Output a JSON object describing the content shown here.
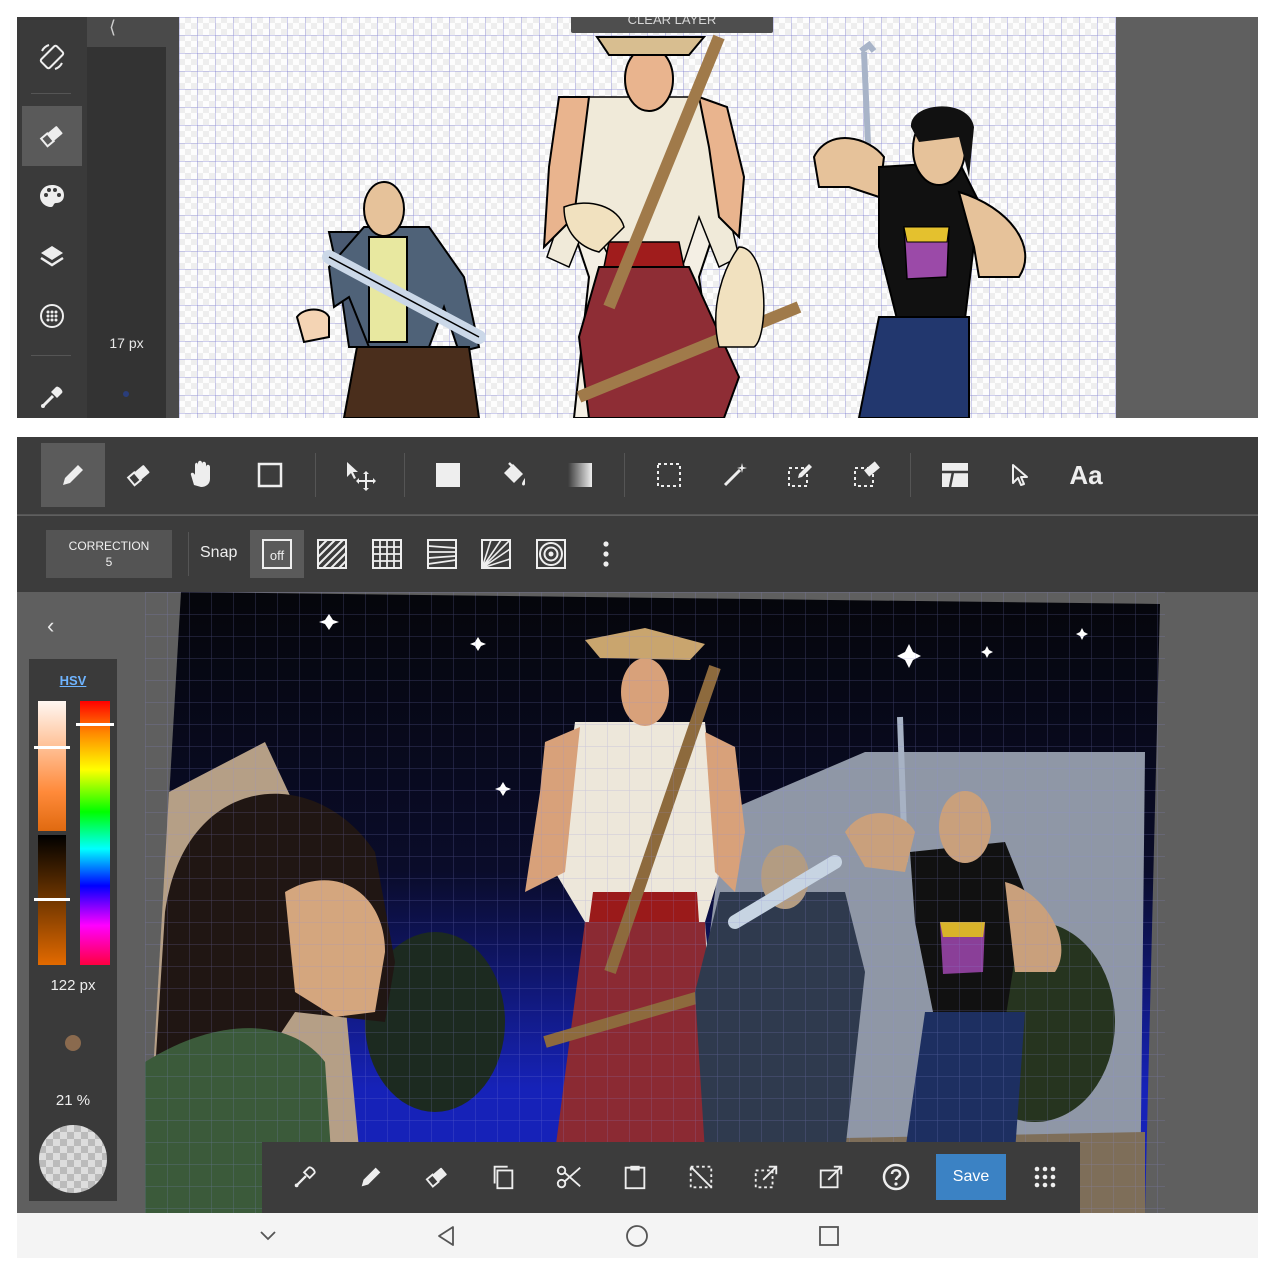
{
  "top_screen": {
    "overlay_button": "CLEAR LAYER",
    "brush_size": "17 px",
    "rail_tools": [
      "rotate-icon",
      "eraser-icon",
      "palette-icon",
      "layers-icon",
      "grid-icon",
      "eyedropper-icon"
    ],
    "active_tool": "eraser-icon"
  },
  "bottom_screen": {
    "main_tools": [
      "pencil-icon",
      "eraser-icon",
      "hand-icon",
      "rectangle-icon",
      "move-icon",
      "fill-rect-icon",
      "bucket-icon",
      "gradient-icon",
      "select-rect-icon",
      "magic-wand-icon",
      "select-pen-icon",
      "select-eraser-icon",
      "layout-icon",
      "pointer-icon",
      "text-icon"
    ],
    "text_tool_label": "Aa",
    "correction_label": "CORRECTION",
    "correction_value": "5",
    "snap_label": "Snap",
    "snap_off_label": "off",
    "color_mode": "HSV",
    "brush_size": "122 px",
    "opacity": "21 %",
    "save_label": "Save",
    "bottom_tools": [
      "eyedropper-icon",
      "pencil-icon",
      "eraser-icon",
      "copy-icon",
      "cut-icon",
      "paste-icon",
      "deselect-icon",
      "export-icon",
      "import-icon",
      "help-icon"
    ]
  },
  "colors": {
    "accent": "#3b82c4",
    "toolbar": "#3c3c3c",
    "hsv_link": "#6fb4ff"
  }
}
